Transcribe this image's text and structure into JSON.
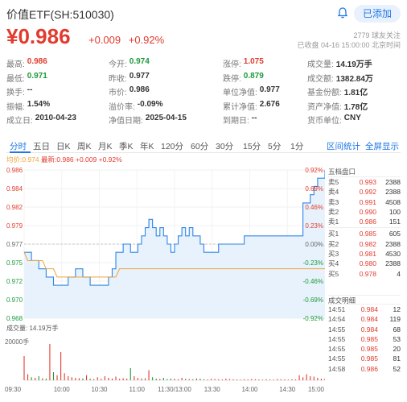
{
  "header": {
    "title": "价值ETF(SH:510030)",
    "follow_label": "已添加",
    "price": "¥0.986",
    "change": "+0.009",
    "change_pct": "+0.92%",
    "followers": "2779  球友关注",
    "status": "已收盘  04-16  15:00:00  北京时间"
  },
  "stats": [
    [
      {
        "l": "最高:",
        "v": "0.986",
        "c": "red"
      },
      {
        "l": "今开:",
        "v": "0.974",
        "c": "green"
      },
      {
        "l": "涨停:",
        "v": "1.075",
        "c": "red"
      },
      {
        "l": "成交量:",
        "v": "14.19万手",
        "c": ""
      }
    ],
    [
      {
        "l": "最低:",
        "v": "0.971",
        "c": "green"
      },
      {
        "l": "昨收:",
        "v": "0.977",
        "c": ""
      },
      {
        "l": "跌停:",
        "v": "0.879",
        "c": "green"
      },
      {
        "l": "成交额:",
        "v": "1382.84万",
        "c": ""
      }
    ],
    [
      {
        "l": "换手:",
        "v": "--",
        "c": ""
      },
      {
        "l": "市价:",
        "v": "0.986",
        "c": ""
      },
      {
        "l": "单位净值:",
        "v": "0.977",
        "c": ""
      },
      {
        "l": "基金份额:",
        "v": "1.81亿",
        "c": ""
      }
    ],
    [
      {
        "l": "振幅:",
        "v": "1.54%",
        "c": ""
      },
      {
        "l": "溢价率:",
        "v": "-0.09%",
        "c": ""
      },
      {
        "l": "累计净值:",
        "v": "2.676",
        "c": ""
      },
      {
        "l": "资产净值:",
        "v": "1.78亿",
        "c": ""
      }
    ],
    [
      {
        "l": "成立日:",
        "v": "2010-04-23",
        "c": ""
      },
      {
        "l": "净值日期:",
        "v": "2025-04-15",
        "c": ""
      },
      {
        "l": "到期日:",
        "v": "--",
        "c": ""
      },
      {
        "l": "货币单位:",
        "v": "CNY",
        "c": ""
      }
    ]
  ],
  "tabs": [
    "分时",
    "五日",
    "日K",
    "周K",
    "月K",
    "季K",
    "年K",
    "120分",
    "60分",
    "30分",
    "15分",
    "5分",
    "1分"
  ],
  "tab_right": [
    "区间统计",
    "全屏显示"
  ],
  "legend": {
    "avg": "均价:0.974",
    "latest": "最新:0.986 +0.009 +0.92%"
  },
  "volume_label": "成交量: 14.19万手",
  "volume_axis": "20000手",
  "order_book": {
    "title": "五档盘口",
    "asks": [
      {
        "name": "卖5",
        "price": "0.993",
        "vol": "2388"
      },
      {
        "name": "卖4",
        "price": "0.992",
        "vol": "2388"
      },
      {
        "name": "卖3",
        "price": "0.991",
        "vol": "4508"
      },
      {
        "name": "卖2",
        "price": "0.990",
        "vol": "100"
      },
      {
        "name": "卖1",
        "price": "0.986",
        "vol": "151"
      }
    ],
    "bids": [
      {
        "name": "买1",
        "price": "0.985",
        "vol": "605"
      },
      {
        "name": "买2",
        "price": "0.982",
        "vol": "2388"
      },
      {
        "name": "买3",
        "price": "0.981",
        "vol": "4530"
      },
      {
        "name": "买4",
        "price": "0.980",
        "vol": "2388"
      },
      {
        "name": "买5",
        "price": "0.978",
        "vol": "4"
      }
    ]
  },
  "trades": {
    "title": "成交明细",
    "rows": [
      {
        "t": "14:51",
        "p": "0.984",
        "v": "12"
      },
      {
        "t": "14:54",
        "p": "0.984",
        "v": "119"
      },
      {
        "t": "14:55",
        "p": "0.984",
        "v": "68"
      },
      {
        "t": "14:55",
        "p": "0.985",
        "v": "53"
      },
      {
        "t": "14:55",
        "p": "0.985",
        "v": "20"
      },
      {
        "t": "14:55",
        "p": "0.985",
        "v": "81"
      },
      {
        "t": "14:58",
        "p": "0.986",
        "v": "52"
      }
    ]
  },
  "colors": {
    "up": "#e23b2e",
    "down": "#1a9b3a",
    "accent": "#1e78e6",
    "avg": "#f0a23a"
  },
  "chart_data": {
    "type": "line",
    "y_labels": [
      "0.986",
      "0.984",
      "0.982",
      "0.979",
      "0.977",
      "0.975",
      "0.972",
      "0.970",
      "0.968"
    ],
    "pct_labels": [
      "0.92%",
      "0.69%",
      "0.46%",
      "0.23%",
      "0.00%",
      "-0.23%",
      "-0.46%",
      "-0.69%",
      "-0.92%"
    ],
    "x_labels": [
      "09:30",
      "10:00",
      "10:30",
      "11:00",
      "11:30/13:00",
      "13:30",
      "14:00",
      "14:30",
      "15:00"
    ],
    "ylim": [
      0.968,
      0.986
    ],
    "prev_close": 0.977,
    "price": [
      0.976,
      0.976,
      0.975,
      0.975,
      0.974,
      0.974,
      0.973,
      0.973,
      0.972,
      0.972,
      0.972,
      0.972,
      0.973,
      0.973,
      0.974,
      0.974,
      0.973,
      0.973,
      0.972,
      0.972,
      0.972,
      0.972,
      0.972,
      0.973,
      0.974,
      0.976,
      0.976,
      0.977,
      0.977,
      0.976,
      0.976,
      0.977,
      0.978,
      0.979,
      0.98,
      0.979,
      0.978,
      0.979,
      0.978,
      0.977,
      0.976,
      0.977,
      0.978,
      0.979,
      0.978,
      0.979,
      0.978,
      0.978,
      0.977,
      0.976,
      0.976,
      0.976,
      0.976,
      0.977,
      0.977,
      0.977,
      0.977,
      0.977,
      0.977,
      0.977,
      0.978,
      0.978,
      0.978,
      0.978,
      0.978,
      0.978,
      0.978,
      0.978,
      0.978,
      0.978,
      0.978,
      0.978,
      0.978,
      0.978,
      0.978,
      0.978,
      0.982,
      0.982,
      0.983,
      0.984,
      0.985,
      0.985,
      0.986
    ],
    "avg": [
      0.976,
      0.975,
      0.975,
      0.975,
      0.975,
      0.975,
      0.974,
      0.974,
      0.974,
      0.973,
      0.973,
      0.973,
      0.973,
      0.973,
      0.973,
      0.973,
      0.973,
      0.973,
      0.973,
      0.973,
      0.973,
      0.973,
      0.973,
      0.973,
      0.973,
      0.973,
      0.974,
      0.974,
      0.974,
      0.974,
      0.974,
      0.974,
      0.974,
      0.974,
      0.974,
      0.974,
      0.974,
      0.974,
      0.974,
      0.974,
      0.974,
      0.974,
      0.974,
      0.974,
      0.974,
      0.974,
      0.974,
      0.974,
      0.974,
      0.974,
      0.974,
      0.974,
      0.974,
      0.974,
      0.974,
      0.974,
      0.974,
      0.974,
      0.974,
      0.974,
      0.974,
      0.974,
      0.974,
      0.974,
      0.974,
      0.974,
      0.974,
      0.974,
      0.974,
      0.974,
      0.974,
      0.974,
      0.974,
      0.974,
      0.974,
      0.974,
      0.974,
      0.974,
      0.974,
      0.974,
      0.974,
      0.974,
      0.974
    ],
    "volume": [
      12000,
      3000,
      1500,
      1200,
      2000,
      1000,
      800,
      18000,
      4000,
      2500,
      14000,
      3500,
      2000,
      1500,
      1200,
      1000,
      900,
      2500,
      800,
      600,
      1500,
      700,
      2000,
      1200,
      900,
      1800,
      700,
      1000,
      800,
      6000,
      2000,
      1200,
      900,
      1000,
      5000,
      1500,
      800,
      700,
      1200,
      600,
      800,
      700,
      500,
      1200,
      700,
      600,
      500,
      900,
      800,
      500,
      400,
      700,
      600,
      500,
      400,
      800,
      600,
      500,
      400,
      300,
      500,
      400,
      600,
      500,
      400,
      300,
      500,
      400,
      300,
      600,
      500,
      400,
      300,
      500,
      400,
      2500,
      1500,
      3000,
      2000,
      1800,
      1200,
      800,
      900
    ],
    "volume_max": 20000
  }
}
